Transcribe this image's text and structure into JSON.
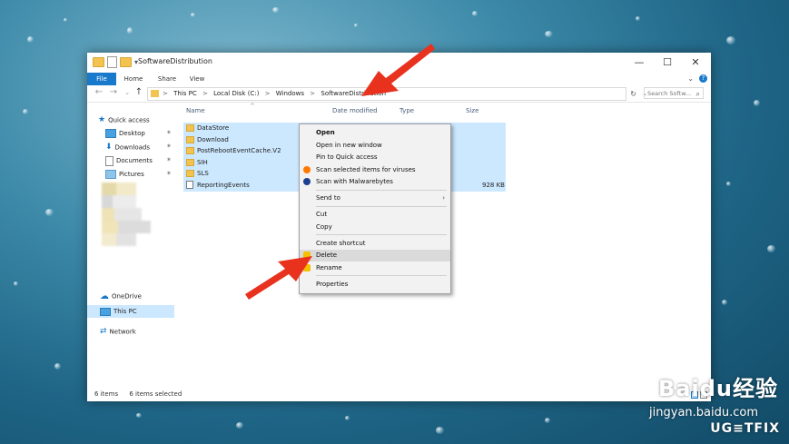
{
  "window": {
    "title": "SoftwareDistribution",
    "controls": {
      "minimize": "—",
      "maximize": "☐",
      "close": "✕"
    }
  },
  "ribbon": {
    "tabs": [
      "File",
      "Home",
      "Share",
      "View"
    ],
    "expand_glyph": "⌄",
    "help_glyph": "?"
  },
  "address": {
    "back": "←",
    "forward": "→",
    "recent": "⌄",
    "up": "↑",
    "breadcrumbs": [
      "This PC",
      "Local Disk (C:)",
      "Windows",
      "SoftwareDistribution"
    ],
    "separator": ">",
    "dropdown": "⌄",
    "refresh": "↻",
    "search_placeholder": "Search Softw...",
    "search_glyph": "⌕"
  },
  "nav": {
    "quick_access": "Quick access",
    "items": [
      {
        "label": "Desktop",
        "icon": "desktop-icon",
        "pinned": true
      },
      {
        "label": "Downloads",
        "icon": "download-icon",
        "pinned": true
      },
      {
        "label": "Documents",
        "icon": "documents-icon",
        "pinned": true
      },
      {
        "label": "Pictures",
        "icon": "pictures-icon",
        "pinned": true
      }
    ],
    "pin_glyph": "✶",
    "onedrive": "OneDrive",
    "this_pc": "This PC",
    "network": "Network"
  },
  "files": {
    "sort_glyph": "^",
    "columns": [
      "Name",
      "Date modified",
      "Type",
      "Size"
    ],
    "rows": [
      {
        "name": "DataStore",
        "kind": "folder",
        "size": ""
      },
      {
        "name": "Download",
        "kind": "folder",
        "size": ""
      },
      {
        "name": "PostRebootEventCache.V2",
        "kind": "folder",
        "size": ""
      },
      {
        "name": "SIH",
        "kind": "folder",
        "size": ""
      },
      {
        "name": "SLS",
        "kind": "folder",
        "size": ""
      },
      {
        "name": "ReportingEvents",
        "kind": "file",
        "size": "928 KB"
      }
    ]
  },
  "status": {
    "items": "6 items",
    "selected": "6 items selected"
  },
  "context_menu": {
    "open": "Open",
    "open_new_window": "Open in new window",
    "pin_quick_access": "Pin to Quick access",
    "scan_viruses": "Scan selected items for viruses",
    "scan_malwarebytes": "Scan with Malwarebytes",
    "send_to": "Send to",
    "send_to_arrow": "›",
    "cut": "Cut",
    "copy": "Copy",
    "create_shortcut": "Create shortcut",
    "delete": "Delete",
    "rename": "Rename",
    "properties": "Properties",
    "highlighted": "Delete"
  },
  "watermarks": {
    "baidu": "Baidu经验",
    "jingyan": "jingyan.baidu.com",
    "ugetfix": "UG≡TFIX"
  },
  "colors": {
    "accent": "#1979ca",
    "selection": "#cce8ff",
    "callout": "#e8321e"
  }
}
